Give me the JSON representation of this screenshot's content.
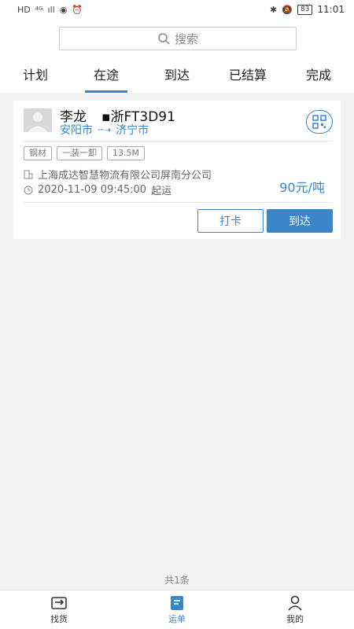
{
  "status_bar": {
    "left_glyphs": [
      "HD",
      "⁴ᴳ",
      "ıll",
      "◉",
      "⏰"
    ],
    "battery": "83",
    "time": "11:01"
  },
  "search": {
    "placeholder": "搜索"
  },
  "tabs": [
    {
      "label": "计划"
    },
    {
      "label": "在途",
      "active": true
    },
    {
      "label": "到达"
    },
    {
      "label": "已结算"
    },
    {
      "label": "完成"
    }
  ],
  "order": {
    "driver": "李龙",
    "plate": "▪浙FT3D91",
    "origin": "安阳市",
    "destination": "济宁市",
    "tags": [
      "钢材",
      "一装一卸",
      "13.5M"
    ],
    "company": "上海成达智慧物流有限公司屏南分公司",
    "datetime": "2020-11-09 09:45:00",
    "status_suffix": "起运",
    "price": "90元/吨",
    "btn_checkin": "打卡",
    "btn_arrive": "到达"
  },
  "footer": {
    "total": "共1条"
  },
  "nav": [
    {
      "label": "找货"
    },
    {
      "label": "运单",
      "active": true
    },
    {
      "label": "我的"
    }
  ],
  "colors": {
    "accent": "#3a86c8"
  }
}
